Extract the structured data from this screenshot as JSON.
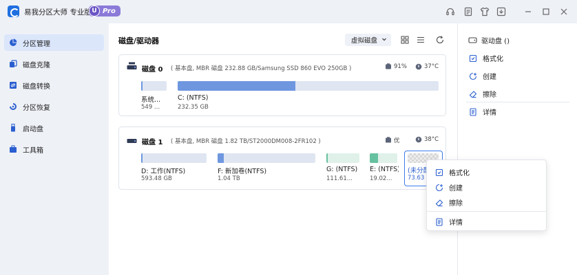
{
  "app": {
    "title": "易我分区大师 专业版",
    "pro_u": "U",
    "pro_label": "Pro"
  },
  "titlebar_icons": [
    "headset-icon",
    "feedback-icon",
    "shirt-icon",
    "update-icon",
    "minimize-icon",
    "maximize-icon",
    "close-icon"
  ],
  "sidebar": {
    "items": [
      {
        "label": "分区管理",
        "icon": "pie-icon",
        "active": true
      },
      {
        "label": "磁盘克隆",
        "icon": "clone-icon",
        "active": false
      },
      {
        "label": "磁盘转换",
        "icon": "convert-icon",
        "active": false
      },
      {
        "label": "分区恢复",
        "icon": "recover-icon",
        "active": false
      },
      {
        "label": "启动盘",
        "icon": "usb-icon",
        "active": false
      },
      {
        "label": "工具箱",
        "icon": "toolbox-icon",
        "active": false
      }
    ]
  },
  "main": {
    "title": "磁盘/驱动器",
    "virtual_disk_label": "虚拟磁盘",
    "disks": [
      {
        "name": "磁盘 0",
        "info": "( 基本盘, MBR 磁盘 232.88 GB/Samsung SSD 860 EVO 250GB )",
        "health": "91%",
        "temp": "37°C",
        "partitions": [
          {
            "name": "系统...",
            "size": "549 ...",
            "used": 0.05,
            "color": "blue"
          },
          {
            "name": "C: (NTFS)",
            "size": "232.35 GB",
            "used": 0.45,
            "color": "blue"
          }
        ]
      },
      {
        "name": "磁盘 1",
        "info": "( 基本盘, MBR 磁盘 1.82 TB/ST2000DM008-2FR102 )",
        "health": "优",
        "temp": "38°C",
        "partitions": [
          {
            "name": "D: 工作(NTFS)",
            "size": "593.48 GB",
            "used": 0.02,
            "color": "blue"
          },
          {
            "name": "F: 新加卷(NTFS)",
            "size": "1.04 TB",
            "used": 0.06,
            "color": "blue"
          },
          {
            "name": "G: (NTFS)",
            "size": "111.61...",
            "used": 0.05,
            "color": "green"
          },
          {
            "name": "E: (NTFS)",
            "size": "19.02...",
            "used": 0.3,
            "color": "green"
          },
          {
            "name": "(未分配)",
            "size": "73.63 ...",
            "used": 0,
            "color": "unallocated"
          }
        ]
      }
    ]
  },
  "right_panel": {
    "header": "驱动盘 ()",
    "actions": [
      {
        "label": "格式化",
        "icon": "format-icon"
      },
      {
        "label": "创建",
        "icon": "create-icon"
      },
      {
        "label": "擦除",
        "icon": "eraser-icon"
      }
    ],
    "details_label": "详情"
  },
  "context_menu": {
    "items": [
      {
        "label": "格式化",
        "icon": "format-icon"
      },
      {
        "label": "创建",
        "icon": "create-icon"
      },
      {
        "label": "擦除",
        "icon": "eraser-icon"
      }
    ],
    "details_label": "详情"
  },
  "colors": {
    "accent": "#2b5fd0",
    "partition_blue": "#6f97e0",
    "partition_green": "#66c1a0",
    "selected_border": "#3b7bea"
  }
}
